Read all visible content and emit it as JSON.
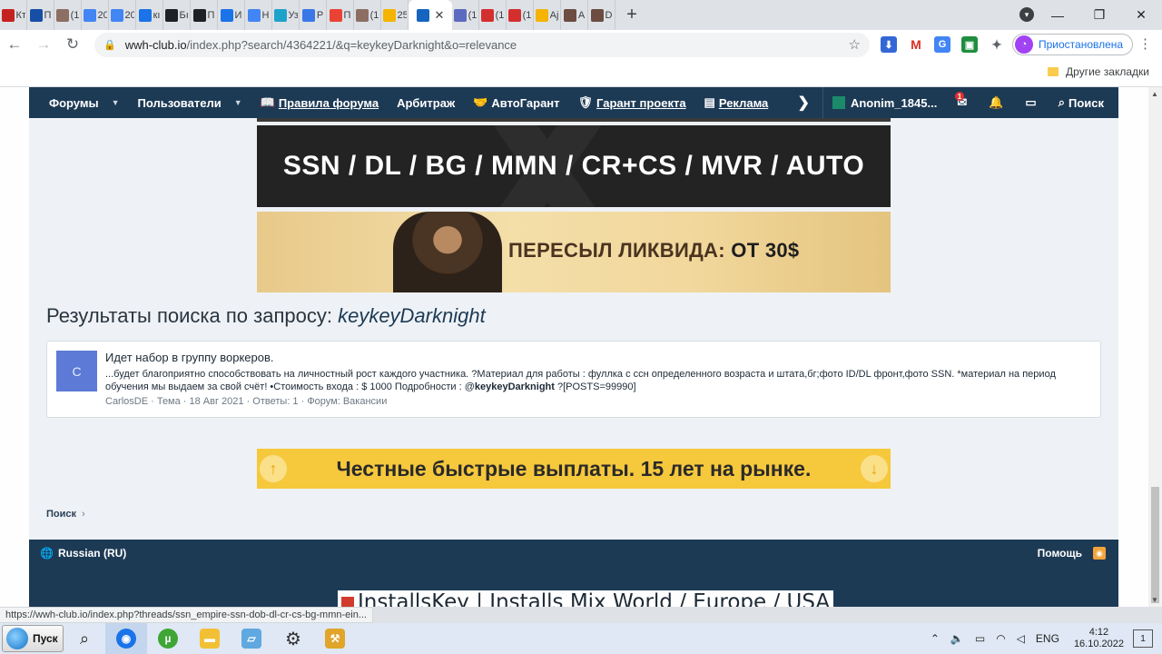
{
  "browser": {
    "tabs": [
      {
        "label": "Кт",
        "color": "#c5221f"
      },
      {
        "label": "П",
        "color": "#174ea6"
      },
      {
        "label": "(1",
        "color": "#8d6e63"
      },
      {
        "label": "20",
        "color": "#4285f4"
      },
      {
        "label": "20",
        "color": "#4285f4"
      },
      {
        "label": "кı",
        "color": "#1a73e8"
      },
      {
        "label": "Бı",
        "color": "#202124"
      },
      {
        "label": "П",
        "color": "#202124"
      },
      {
        "label": "И",
        "color": "#1a73e8"
      },
      {
        "label": "Н",
        "color": "#4285f4"
      },
      {
        "label": "Уз",
        "color": "#1fa2c9"
      },
      {
        "label": "Р",
        "color": "#3b78e7"
      },
      {
        "label": "П",
        "color": "#ea4335"
      },
      {
        "label": "(1",
        "color": "#8d6e63"
      },
      {
        "label": "25",
        "color": "#f4b400"
      }
    ],
    "active_tab_label": "",
    "tabs_after": [
      {
        "label": "(1",
        "color": "#5c6bc0"
      },
      {
        "label": "(1",
        "color": "#d32f2f"
      },
      {
        "label": "(1",
        "color": "#d32f2f"
      },
      {
        "label": "Ај",
        "color": "#f4b400"
      },
      {
        "label": "А",
        "color": "#6d4c41"
      },
      {
        "label": "D",
        "color": "#6d4c41"
      }
    ],
    "new_tab": "+",
    "url_host": "wwh-club.io",
    "url_path": "/index.php?search/4364221/&q=keykeyDarknight&o=relevance",
    "profile_label": "Приостановлена",
    "bookmarks_other": "Другие закладки",
    "status_url": "https://wwh-club.io/index.php?threads/ssn_empire-ssn-dob-dl-cr-cs-bg-mmn-ein..."
  },
  "forum_nav": {
    "items": [
      {
        "label": "Форумы",
        "caret": true
      },
      {
        "label": "Пользователи",
        "caret": true
      },
      {
        "label": "Правила форума",
        "icon": "book-icon",
        "underline": true
      },
      {
        "label": "Арбитраж"
      },
      {
        "label": "АвтоГарант",
        "icon": "handshake-icon"
      },
      {
        "label": "Гарант проекта",
        "icon": "shield-icon",
        "underline": true
      },
      {
        "label": "Реклама",
        "icon": "ad-icon",
        "underline": true
      }
    ],
    "user": "Anonim_1845...",
    "alerts_badge": "1",
    "search_label": "Поиск"
  },
  "banners": {
    "top": "SSN / DL / BG / MMN / CR+CS / MVR / AUTO",
    "middle_text": "ПЕРЕСЫЛ ЛИКВИДА:",
    "middle_bold": "ОТ 30$",
    "bottom": "Честные быстрые выплаты. 15 лет на рынке."
  },
  "search": {
    "title_prefix": "Результаты поиска по запросу:",
    "query": "keykeyDarknight"
  },
  "result": {
    "avatar_letter": "C",
    "title": "Идет набор в группу воркеров.",
    "snippet_before": "...будет благоприятно способствовать на личностный рост каждого участника. ?Материал для работы : фуллка с ссн определенного возраста и штата,бг;фото ID/DL фронт,фото SSN. *материал на период обучения мы выдаем за свой счёт! •Стоимость входа : $ 1000 Подробности : @",
    "snippet_bold": "keykeyDarknight",
    "snippet_after": " ?[POSTS=99990]",
    "meta": "CarlosDE · Тема · 18 Авг 2021 · Ответы: 1 · Форум: Вакансии"
  },
  "breadcrumb": "Поиск",
  "footer": {
    "language": "Russian (RU)",
    "help": "Помощь"
  },
  "installs_text": "InstallsKey | Installs Mix World / Europe / USA",
  "taskbar": {
    "start": "Пуск",
    "lang": "ENG",
    "time": "4:12",
    "date": "16.10.2022",
    "notifications": "1"
  }
}
